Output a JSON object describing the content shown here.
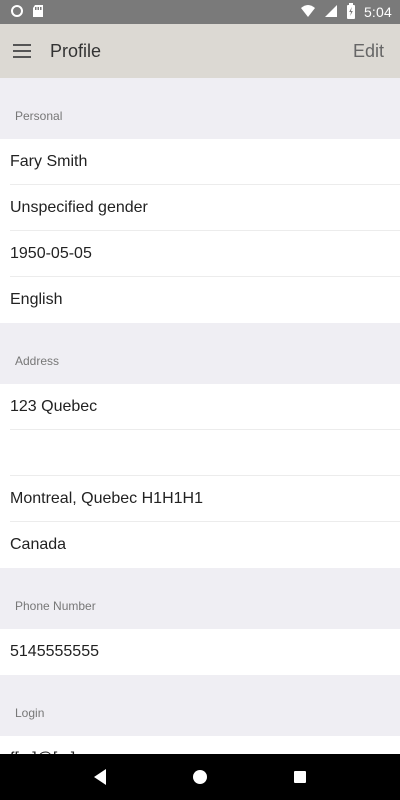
{
  "status_bar": {
    "time": "5:04"
  },
  "app_bar": {
    "title": "Profile",
    "edit_label": "Edit"
  },
  "sections": {
    "personal": {
      "header": "Personal",
      "name": "Fary Smith",
      "gender": "Unspecified gender",
      "birthdate": "1950-05-05",
      "language": "English"
    },
    "address": {
      "header": "Address",
      "line1": "123 Quebec",
      "line2": "",
      "city_line": "Montreal, Quebec H1H1H1",
      "country": "Canada"
    },
    "phone": {
      "header": "Phone Number",
      "number": "5145555555"
    },
    "login": {
      "header": "Login",
      "value": "f[...]@[...]"
    }
  },
  "icons": {
    "status_left": [
      "circle-icon",
      "sd-card-icon"
    ],
    "status_right": [
      "wifi-icon",
      "signal-icon",
      "battery-icon"
    ],
    "menu": "hamburger-menu-icon",
    "nav": [
      "back-triangle-icon",
      "home-circle-icon",
      "recents-square-icon"
    ]
  },
  "colors": {
    "status_bar": "#7a7a7a",
    "app_bar": "#dcd9d3",
    "background": "#efeef3",
    "row_background": "#ffffff",
    "nav_bar": "#000000"
  }
}
